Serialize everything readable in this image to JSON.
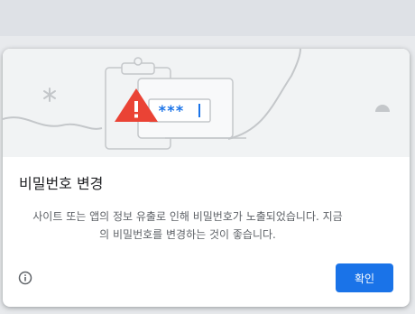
{
  "dialog": {
    "title": "비밀번호 변경",
    "body_line1": "사이트 또는 앱의 정보 유출로 인해 비밀번호가 노출되었습니다. 지금",
    "body_line2": "의 비밀번호를 변경하는 것이 좋습니다.",
    "ok_label": "확인",
    "illustration_password_mask": "***",
    "icons": {
      "info": "info-circle-icon",
      "warning": "warning-triangle-icon"
    },
    "colors": {
      "accent": "#1a73e8",
      "warning": "#ea4335",
      "password": "#1a73e8"
    }
  }
}
